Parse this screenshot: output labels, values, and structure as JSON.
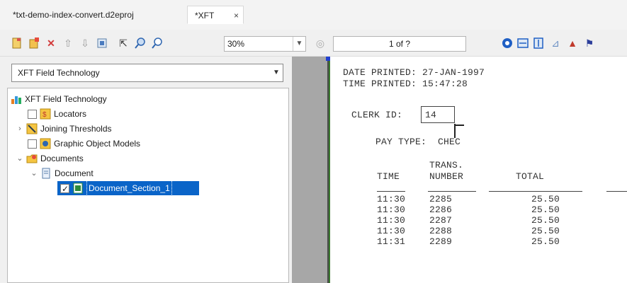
{
  "tabs": [
    {
      "label": "*txt-demo-index-convert.d2eproj",
      "active": false
    },
    {
      "label": "*XFT",
      "active": true,
      "close": "×"
    }
  ],
  "toolbar": {
    "icons": [
      "new-icon",
      "add-icon",
      "delete-icon",
      "move-up-icon",
      "move-down-icon",
      "properties-icon",
      "pointer-icon",
      "zoom-in-icon",
      "zoom-out-icon"
    ],
    "zoom_value": "30%",
    "page_value": "1 of ?",
    "right_icons": [
      "info-icon",
      "fit-width-icon",
      "fit-height-icon",
      "chart-icon",
      "warning-icon",
      "flag-icon"
    ]
  },
  "left_panel": {
    "selector_value": "XFT Field Technology",
    "tree": [
      {
        "label": "XFT Field Technology",
        "icon": "app-icon",
        "level": 0
      },
      {
        "label": "Locators",
        "icon": "locator-icon",
        "level": 1,
        "checkbox": true
      },
      {
        "label": "Joining Thresholds",
        "icon": "threshold-icon",
        "level": 1,
        "expander": ">"
      },
      {
        "label": "Graphic Object Models",
        "icon": "graphic-model-icon",
        "level": 1,
        "checkbox": true
      },
      {
        "label": "Documents",
        "icon": "documents-icon",
        "level": 1,
        "expander": "v"
      },
      {
        "label": "Document",
        "icon": "document-icon",
        "level": 2,
        "expander": "v"
      },
      {
        "label": "Document_Section_1",
        "icon": "section-icon",
        "level": 3,
        "checkbox": true,
        "checked": true,
        "selected": true
      }
    ]
  },
  "document": {
    "date_line": "DATE PRINTED: 27-JAN-1997",
    "time_line": "TIME PRINTED: 15:47:28",
    "clerk_label": "CLERK ID:",
    "clerk_value": "14",
    "pay_type": "PAY TYPE:  CHEC",
    "col_time": "TIME",
    "col_trans_top": "TRANS.",
    "col_trans_bottom": "NUMBER",
    "col_total": "TOTAL",
    "rows": [
      {
        "time": "11:30",
        "number": "2285",
        "total": "25.50"
      },
      {
        "time": "11:30",
        "number": "2286",
        "total": "25.50"
      },
      {
        "time": "11:30",
        "number": "2287",
        "total": "25.50"
      },
      {
        "time": "11:30",
        "number": "2288",
        "total": "25.50"
      },
      {
        "time": "11:31",
        "number": "2289",
        "total": "25.50"
      }
    ]
  },
  "colors": {
    "selection": "#0a64c8",
    "page_border": "#3b7a2f",
    "gutter": "#a7a7a7"
  }
}
